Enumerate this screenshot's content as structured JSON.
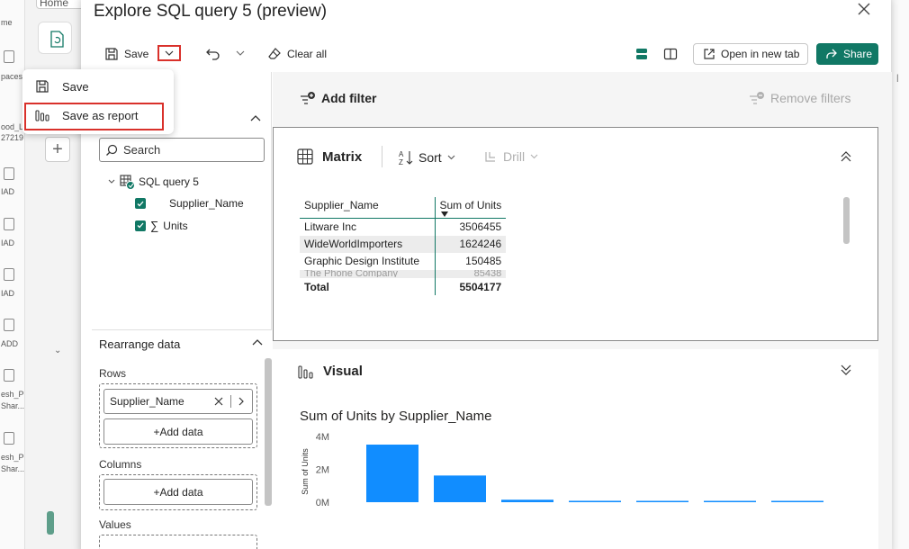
{
  "background": {
    "home_tab": "Home",
    "left_labels": [
      "me",
      "paces",
      "ood_L",
      "27219",
      "IAD",
      "IAD",
      "IAD",
      "ADD",
      "esh_P",
      "Shar...",
      "esh_P",
      "Shar..."
    ]
  },
  "dialog": {
    "title": "Explore SQL query 5 (preview)",
    "toolbar": {
      "save_label": "Save",
      "clear_all_label": "Clear all",
      "open_in_new_tab_label": "Open in new tab",
      "share_label": "Share"
    }
  },
  "save_menu": {
    "items": [
      {
        "label": "Save"
      },
      {
        "label": "Save as report"
      }
    ]
  },
  "data_pane": {
    "search_placeholder": "Search",
    "tree": {
      "root": "SQL query 5",
      "fields": [
        {
          "label": "Supplier_Name",
          "checked": true,
          "sigma": false
        },
        {
          "label": "Units",
          "checked": true,
          "sigma": true
        }
      ]
    }
  },
  "rearrange": {
    "title": "Rearrange data",
    "rows_label": "Rows",
    "rows_chip": "Supplier_Name",
    "add_data_label": "+Add data",
    "columns_label": "Columns",
    "values_label": "Values"
  },
  "filters": {
    "add_filter_label": "Add filter",
    "remove_filters_label": "Remove filters"
  },
  "matrix": {
    "title": "Matrix",
    "sort_label": "Sort",
    "drill_label": "Drill",
    "columns": [
      "Supplier_Name",
      "Sum of Units"
    ],
    "rows": [
      {
        "name": "Litware Inc",
        "value": "3506455"
      },
      {
        "name": "WideWorldImporters",
        "value": "1624246"
      },
      {
        "name": "Graphic Design Institute",
        "value": "150485"
      },
      {
        "name": "The Phone Company",
        "value": "85438"
      }
    ],
    "total_label": "Total",
    "total_value": "5504177"
  },
  "visual": {
    "title": "Visual"
  },
  "chart_data": {
    "type": "bar",
    "title": "Sum of Units by Supplier_Name",
    "ylabel": "Sum of Units",
    "yticks": [
      "4M",
      "2M",
      "0M"
    ],
    "ylim": [
      0,
      4000000
    ],
    "values": [
      3506455,
      1624246,
      150485,
      85438,
      60000,
      45000,
      35000
    ],
    "bar_color": "#118dff"
  },
  "colors": {
    "accent": "#117865",
    "highlight": "#d9312b"
  }
}
